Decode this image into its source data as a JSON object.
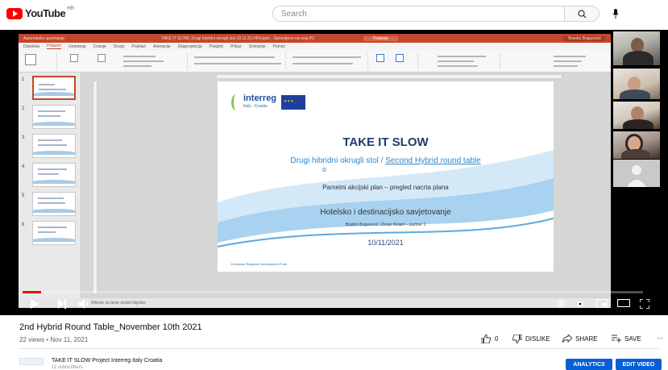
{
  "header": {
    "logo_text": "YouTube",
    "region_code": "HR",
    "search_placeholder": "Search"
  },
  "presentation": {
    "window_title_left": "Automatsko spremanje",
    "window_title_mid": "TAKE IT SLOW_Drugi hibridni okrugli stol 10.11.21.HRV.pptx - Spremljeno na ovaj PC",
    "window_title_search": "Traženje",
    "window_title_user": "Branko Bogunović",
    "menu_items": [
      "Datoteka",
      "Polazno",
      "Umetanje",
      "Crtanje",
      "Dizajn",
      "Prijelazi",
      "Animacije",
      "Dijaprojekcija",
      "Pregled",
      "Prikaz",
      "Snimanje",
      "Pomoć"
    ],
    "active_menu": "Polazno",
    "slide_logo_main": "interreg",
    "slide_logo_sub": "Italy - Croatia",
    "slide_title": "TAKE IT SLOW",
    "slide_subtitle_hr": "Drugi hibridni okrugli stol / ",
    "slide_subtitle_en": "Second Hybrid round table",
    "slide_bullet": "o",
    "slide_line1": "Pametni akcijski plan – pregled nacrta plana",
    "slide_line2": "Hotelsko i destinacijsko savjetovanje",
    "slide_line3": "Branko Bogunović i Zoran Kisiam – partner 1",
    "slide_date": "10/11/2021",
    "slide_footer": "European Regional Development Fund",
    "thumb_numbers": [
      "1",
      "2",
      "3",
      "4",
      "5",
      "6"
    ],
    "status_text": "Kliknite da biste dodali bilješke"
  },
  "video": {
    "progress_percent": 3,
    "title": "2nd Hybrid Round Table_November 10th 2021",
    "views": "22 views",
    "date": "Nov 11, 2021",
    "like_count": "0",
    "dislike_label": "DISLIKE",
    "share_label": "SHARE",
    "save_label": "SAVE",
    "more_label": "···"
  },
  "channel": {
    "name": "TAKE IT SLOW Project Interreg Italy Croatia",
    "subscribers": "11 subscribers",
    "analytics_label": "ANALYTICS",
    "edit_label": "EDIT VIDEO"
  },
  "colors": {
    "youtube_red": "#ff0000",
    "ppt_accent": "#c3472a",
    "slide_title": "#1c3d6e",
    "slide_subtitle": "#2e86c9",
    "button_blue": "#065fd4"
  }
}
